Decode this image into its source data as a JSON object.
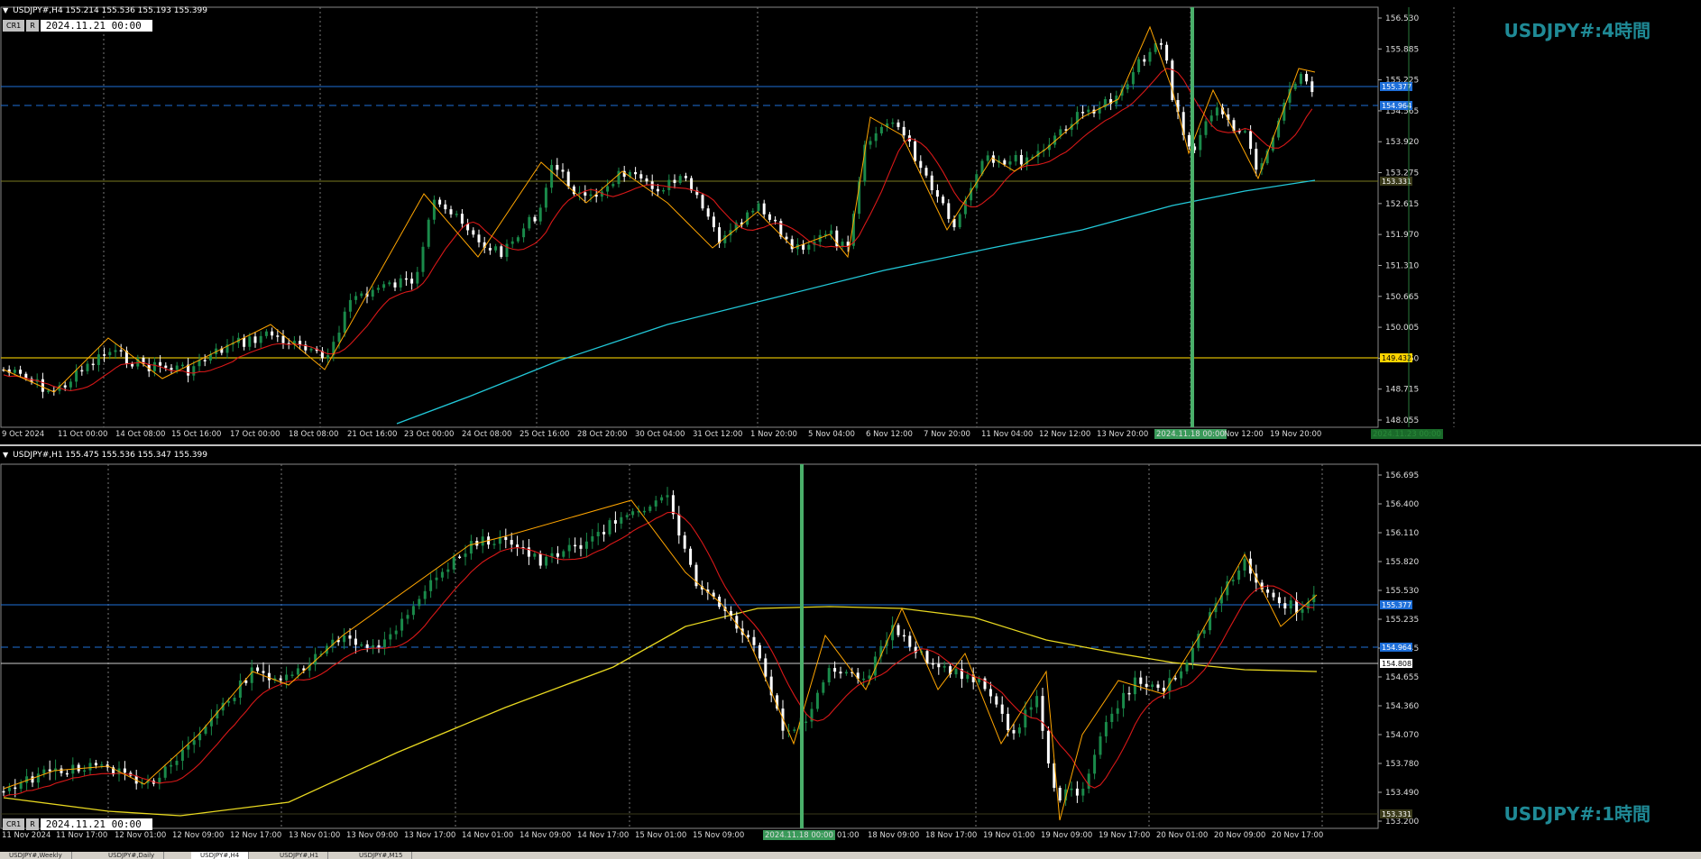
{
  "charts": [
    {
      "id": "top",
      "header": "USDJPY#,H4  155.214 155.536 155.193 155.399",
      "cr_label": "CR1",
      "r_label": "R",
      "date_value": "2024.11.21 00:00",
      "watermark": "USDJPY#:4時間",
      "y_range": [
        148.0,
        156.9
      ],
      "y_ticks": [
        "156.530",
        "155.885",
        "155.225",
        "154.565",
        "153.920",
        "153.275",
        "152.615",
        "151.970",
        "151.310",
        "150.665",
        "150.005",
        "149.360",
        "148.715",
        "148.055"
      ],
      "x_labels": [
        "9 Oct 2024",
        "11 Oct 00:00",
        "14 Oct 08:00",
        "15 Oct 16:00",
        "17 Oct 00:00",
        "18 Oct 08:00",
        "21 Oct 16:00",
        "23 Oct 00:00",
        "24 Oct 08:00",
        "25 Oct 16:00",
        "28 Oct 20:00",
        "30 Oct 04:00",
        "31 Oct 12:00",
        "1 Nov 20:00",
        "5 Nov 04:00",
        "6 Nov 12:00",
        "7 Nov 20:00",
        "11 Nov 04:00",
        "12 Nov 12:00",
        "13 Nov 20:00",
        "2024.11.18 00:00",
        "Nov 12:00",
        "19 Nov 20:00",
        "2024.11.23 00:00"
      ],
      "price_tags": [
        {
          "value": "155.377",
          "color": "#1e6fd9"
        },
        {
          "value": "154.964",
          "color": "#1e6fd9"
        },
        {
          "value": "153.331",
          "color": "#3a3a1a"
        },
        {
          "value": "149.432",
          "color": "#ffd400"
        }
      ],
      "colors": {
        "bull": "#1a8a4a",
        "bear": "#ffffff",
        "ma_fast": "#d81818",
        "ma_slow": "#22c8d8",
        "zigzag": "#ffa500",
        "level_blue": "#1e6fd9",
        "level_yellow": "#d8b800",
        "cursor": "#4aaf6a"
      }
    },
    {
      "id": "bottom",
      "header": "USDJPY#,H1  155.475 155.536 155.347 155.399",
      "cr_label": "CR1",
      "r_label": "R",
      "date_value": "2024.11.21 00:00",
      "watermark": "USDJPY#:1時間",
      "y_range": [
        153.2,
        156.9
      ],
      "y_ticks": [
        "156.695",
        "156.400",
        "156.110",
        "155.820",
        "155.530",
        "155.235",
        "154.945",
        "154.655",
        "154.360",
        "154.070",
        "153.780",
        "153.490",
        "153.200"
      ],
      "x_labels": [
        "11 Nov 2024",
        "11 Nov 17:00",
        "12 Nov 01:00",
        "12 Nov 09:00",
        "12 Nov 17:00",
        "13 Nov 01:00",
        "13 Nov 09:00",
        "13 Nov 17:00",
        "14 Nov 01:00",
        "14 Nov 09:00",
        "14 Nov 17:00",
        "15 Nov 01:00",
        "15 Nov 09:00",
        "2024.11.18 00:00",
        "01:00",
        "18 Nov 09:00",
        "18 Nov 17:00",
        "19 Nov 01:00",
        "19 Nov 09:00",
        "19 Nov 17:00",
        "20 Nov 01:00",
        "20 Nov 09:00",
        "20 Nov 17:00"
      ],
      "price_tags": [
        {
          "value": "155.377",
          "color": "#1e6fd9"
        },
        {
          "value": "154.964",
          "color": "#1e6fd9"
        },
        {
          "value": "154.808",
          "color": "#ffffff"
        },
        {
          "value": "153.331",
          "color": "#3a3a1a"
        }
      ],
      "colors": {
        "bull": "#1a8a4a",
        "bear": "#ffffff",
        "ma_fast": "#d81818",
        "ma_slow": "#e8d820",
        "zigzag": "#ffa500",
        "level_blue": "#1e6fd9",
        "level_white": "#ffffff",
        "cursor": "#4aaf6a"
      }
    }
  ],
  "tabs": [
    "USDJPY#,Weekly",
    "USDJPY#,Daily",
    "USDJPY#,H4",
    "USDJPY#,H1",
    "USDJPY#,M15"
  ],
  "active_tab_index": 2
}
